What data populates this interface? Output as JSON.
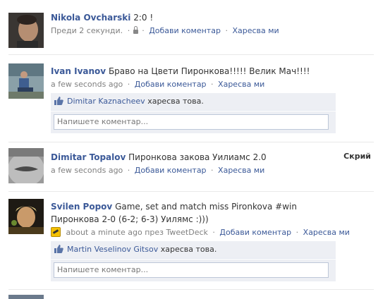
{
  "stories": [
    {
      "author": "Nikola Ovcharski",
      "message": "2:0 !",
      "time": "Преди 2 секунди.",
      "actions": [
        "Добави коментар",
        "Харесва ми"
      ]
    },
    {
      "author": "Ivan Ivanov",
      "message": "Браво на Цвети Пиронкова!!!!! Велик Мач!!!!",
      "time": "a few seconds ago",
      "actions": [
        "Добави коментар",
        "Харесва ми"
      ],
      "likes": {
        "user": "Dimitar Kaznacheev",
        "text": "харесва това."
      },
      "comment_placeholder": "Напишете коментар..."
    },
    {
      "author": "Dimitar Topalov",
      "message": "Пиронкова закова Уилиамс 2.0",
      "time": "a few seconds ago",
      "actions": [
        "Добави коментар",
        "Харесва ми"
      ],
      "hide_label": "Скрий"
    },
    {
      "author": "Svilen Popov",
      "message": "Game, set and match miss Pironkova #win Пиронкова 2-0 (6-2; 6-3) Уилямс :)))",
      "time": "about a minute ago",
      "via": "през TweetDeck",
      "actions": [
        "Добави коментар",
        "Харесва ми"
      ],
      "likes": {
        "user": "Martin Veselinov Gitsov",
        "text": "харесва това."
      },
      "comment_placeholder": "Напишете коментар..."
    }
  ]
}
